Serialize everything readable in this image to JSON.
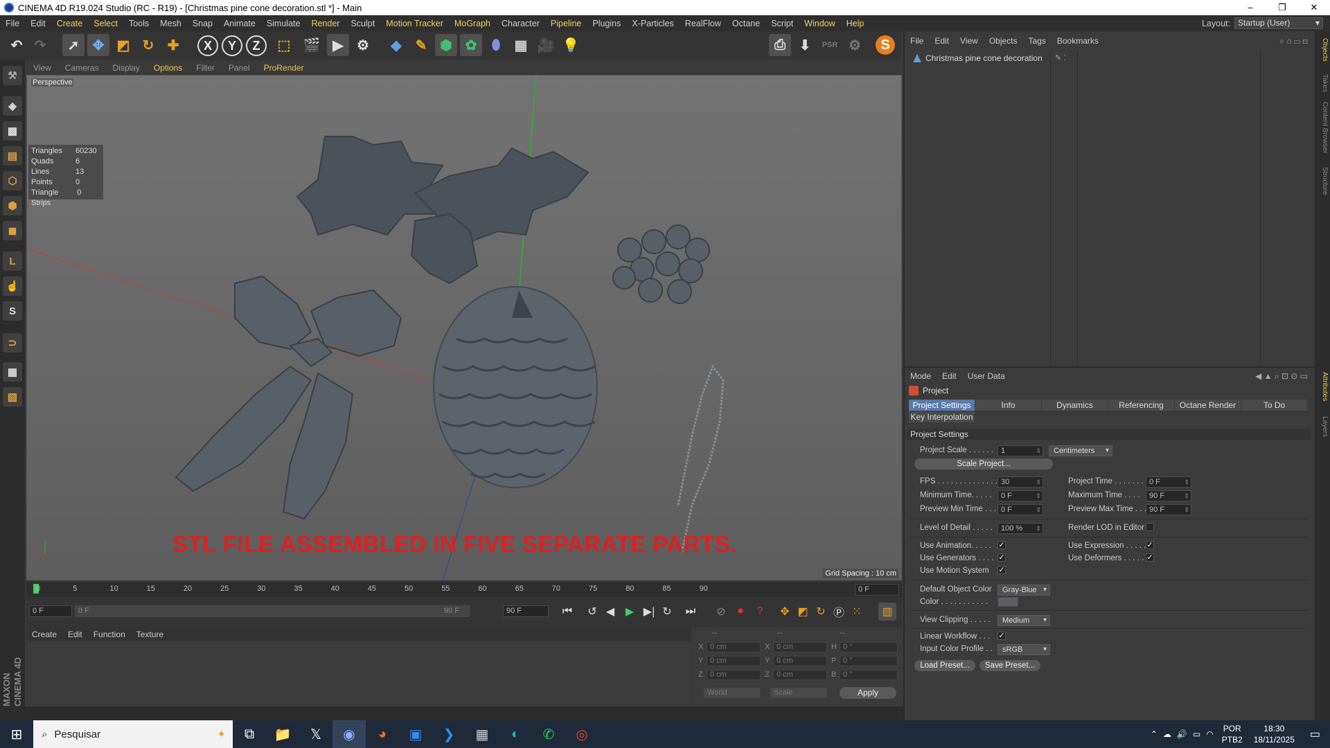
{
  "window": {
    "title": "CINEMA 4D R19.024 Studio (RC - R19) - [Christmas pine cone decoration.stl *] - Main",
    "minimize": "–",
    "maximize": "❐",
    "close": "✕"
  },
  "menubar": {
    "items": [
      "File",
      "Edit",
      "Create",
      "Select",
      "Tools",
      "Mesh",
      "Snap",
      "Animate",
      "Simulate",
      "Render",
      "Sculpt",
      "Motion Tracker",
      "MoGraph",
      "Character",
      "Pipeline",
      "Plugins",
      "X-Particles",
      "RealFlow",
      "Octane",
      "Script",
      "Window",
      "Help"
    ],
    "layout_label": "Layout:",
    "layout_value": "Startup (User)"
  },
  "viewport": {
    "menu": [
      "View",
      "Cameras",
      "Display",
      "Options",
      "Filter",
      "Panel",
      "ProRender"
    ],
    "label": "Perspective",
    "stats": [
      {
        "name": "Triangles",
        "value": "60230"
      },
      {
        "name": "Quads",
        "value": "6"
      },
      {
        "name": "Lines",
        "value": "13"
      },
      {
        "name": "Points",
        "value": "0"
      },
      {
        "name": "Triangle Strips",
        "value": "0"
      }
    ],
    "overlay_text": "STL FILE ASSEMBLED IN FIVE SEPARATE PARTS.",
    "grid_spacing": "Grid Spacing : 10 cm",
    "nav_icons": "✥ ✚ ↻ ▣"
  },
  "timeline": {
    "ticks": [
      "0",
      "5",
      "10",
      "15",
      "20",
      "25",
      "30",
      "35",
      "40",
      "45",
      "50",
      "55",
      "60",
      "65",
      "70",
      "75",
      "80",
      "85",
      "90"
    ],
    "current_frame": "0 F"
  },
  "playback": {
    "start": "0 F",
    "range_start": "0 F",
    "range_end": "90 F",
    "end": "90 F"
  },
  "material_manager": {
    "menu": [
      "Create",
      "Edit",
      "Function",
      "Texture"
    ]
  },
  "coordinates": {
    "header": [
      "--",
      "--",
      "--"
    ],
    "pos_label": [
      "X",
      "Y",
      "Z"
    ],
    "pos_values": [
      "0 cm",
      "0 cm",
      "0 cm"
    ],
    "size_label": [
      "X",
      "Y",
      "Z"
    ],
    "size_values": [
      "0 cm",
      "0 cm",
      "0 cm"
    ],
    "rot_label": [
      "H",
      "P",
      "B"
    ],
    "rot_values": [
      "0 °",
      "0 °",
      "0 °"
    ],
    "mode_world": "World",
    "mode_scale": "Scale",
    "apply": "Apply"
  },
  "brand": {
    "logo": "MAXON CINEMA 4D"
  },
  "object_manager": {
    "menu": [
      "File",
      "Edit",
      "View",
      "Objects",
      "Tags",
      "Bookmarks"
    ],
    "object_name": "Christmas pine cone decoration"
  },
  "right_tabs": [
    "Objects",
    "Takes",
    "Content Browser",
    "Structure"
  ],
  "right_tabs_lower": [
    "Attributes",
    "Layers"
  ],
  "attributes": {
    "menu": [
      "Mode",
      "Edit",
      "User Data"
    ],
    "title": "Project",
    "tabs": [
      "Project Settings",
      "Info",
      "Dynamics",
      "Referencing",
      "Octane Render",
      "To Do"
    ],
    "tab2": "Key Interpolation",
    "section": "Project Settings",
    "project_scale_label": "Project Scale . . . . . .",
    "project_scale_value": "1",
    "project_scale_unit": "Centimeters",
    "scale_project_btn": "Scale Project...",
    "fps_label": "FPS . . . . . . . . . . . . . . .",
    "fps_value": "30",
    "project_time_label": "Project Time . . . . . . . .",
    "project_time_value": "0 F",
    "min_time_label": "Minimum Time. . . . .",
    "min_time_value": "0 F",
    "max_time_label": "Maximum Time . . . .",
    "max_time_value": "90 F",
    "prev_min_label": "Preview Min Time . . .",
    "prev_min_value": "0 F",
    "prev_max_label": "Preview Max Time . . .",
    "prev_max_value": "90 F",
    "lod_label": "Level of Detail . . . . .",
    "lod_value": "100 %",
    "render_lod_label": "Render LOD in Editor",
    "use_anim_label": "Use Animation. . . . .",
    "use_expr_label": "Use Expression . . . . .",
    "use_gen_label": "Use Generators . . . .",
    "use_def_label": "Use Deformers . . . . .",
    "use_motion_label": "Use Motion System",
    "def_color_label": "Default Object Color",
    "def_color_value": "Gray-Blue",
    "color_label": "Color . . . . . . . . . . .",
    "view_clip_label": "View Clipping . . . . .",
    "view_clip_value": "Medium",
    "linear_wf_label": "Linear Workflow . . .",
    "input_cp_label": "Input Color Profile . .",
    "input_cp_value": "sRGB",
    "load_preset": "Load Preset...",
    "save_preset": "Save Preset...",
    "check": "✓"
  },
  "taskbar": {
    "search_placeholder": "Pesquisar",
    "lang_1": "POR",
    "lang_2": "PTB2",
    "time": "18:30",
    "date": "18/11/2025"
  },
  "colors": {
    "accent_yellow": "#e8c850",
    "overlay_red": "#e02020",
    "active_tab": "#5a7aa8"
  }
}
